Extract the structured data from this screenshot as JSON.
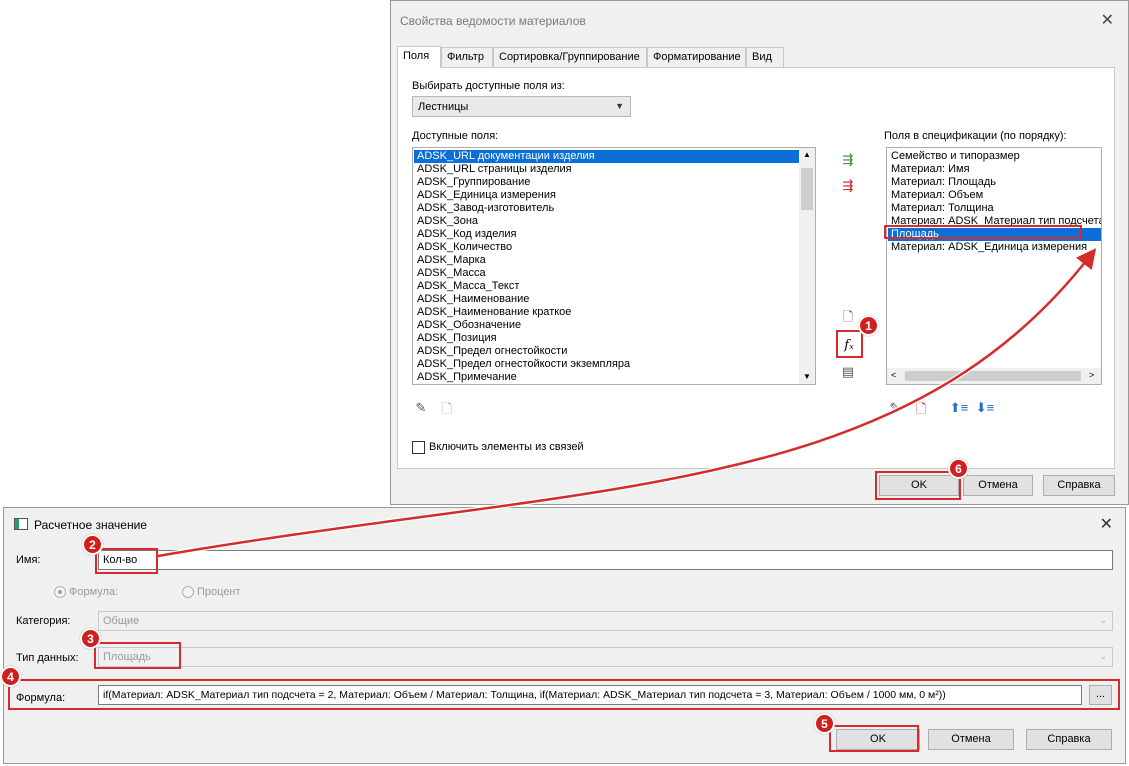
{
  "colors": {
    "accent_red": "#d42c2c",
    "selection_blue": "#0a6fd6"
  },
  "main_dialog": {
    "title": "Свойства ведомости материалов",
    "tabs": [
      "Поля",
      "Фильтр",
      "Сортировка/Группирование",
      "Форматирование",
      "Вид"
    ],
    "select_from_label": "Выбирать доступные поля из:",
    "select_from_value": "Лестницы",
    "available_label": "Доступные поля:",
    "available_fields": [
      "ADSK_URL документации изделия",
      "ADSK_URL страницы изделия",
      "ADSK_Группирование",
      "ADSK_Единица измерения",
      "ADSK_Завод-изготовитель",
      "ADSK_Зона",
      "ADSK_Код изделия",
      "ADSK_Количество",
      "ADSK_Марка",
      "ADSK_Масса",
      "ADSK_Масса_Текст",
      "ADSK_Наименование",
      "ADSK_Наименование краткое",
      "ADSK_Обозначение",
      "ADSK_Позиция",
      "ADSK_Предел огнестойкости",
      "ADSK_Предел огнестойкости экземпляра",
      "ADSK_Примечание"
    ],
    "schedule_label": "Поля в спецификации (по порядку):",
    "schedule_fields": [
      "Семейство и типоразмер",
      "Материал: Имя",
      "Материал: Площадь",
      "Материал: Объем",
      "Материал: Толщина",
      "Материал: ADSK_Материал тип подсчета",
      "Площадь",
      "Материал: ADSK_Единица измерения"
    ],
    "include_links_label": "Включить элементы из связей",
    "ok_label": "OK",
    "cancel_label": "Отмена",
    "help_label": "Справка"
  },
  "calc_dialog": {
    "title": "Расчетное значение",
    "name_label": "Имя:",
    "name_value": "Кол-во",
    "radio_formula": "Формула:",
    "radio_percent": "Процент",
    "category_label": "Категория:",
    "category_value": "Общие",
    "datatype_label": "Тип данных:",
    "datatype_value": "Площадь",
    "formula_label": "Формула:",
    "formula_value": "if(Материал: ADSK_Материал тип подсчета = 2, Материал: Объем / Материал: Толщина, if(Материал: ADSK_Материал тип подсчета = 3, Материал: Объем / 1000 мм, 0 м²))",
    "browse_label": "...",
    "ok_label": "OK",
    "cancel_label": "Отмена",
    "help_label": "Справка"
  },
  "badges": [
    "1",
    "2",
    "3",
    "4",
    "5",
    "6"
  ]
}
